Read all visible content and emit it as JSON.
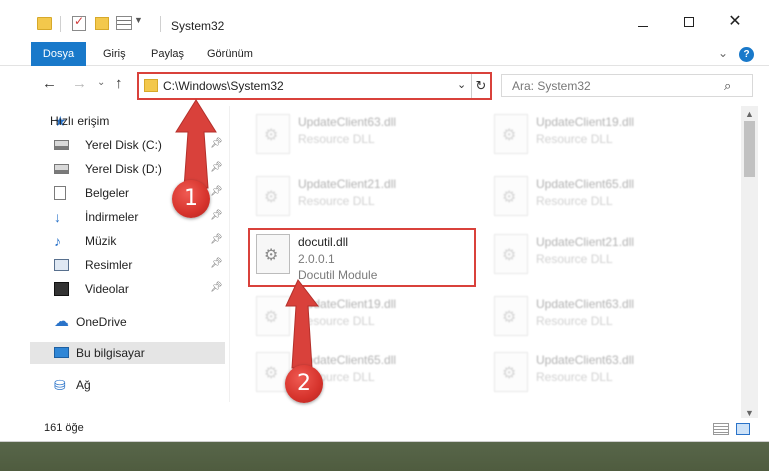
{
  "window": {
    "title": "System32",
    "controls": {
      "minimize": "—",
      "maximize": "",
      "close": "✕"
    }
  },
  "ribbon": {
    "tabs": [
      "Dosya",
      "Giriş",
      "Paylaş",
      "Görünüm"
    ],
    "help": "?",
    "collapse": "⌄"
  },
  "nav": {
    "back": "←",
    "forward": "→",
    "recent": "⌄",
    "up": "↑",
    "address": "C:\\Windows\\System32",
    "address_dropdown": "⌄",
    "refresh": "↻",
    "search_placeholder": "Ara: System32",
    "search_icon": "⚲"
  },
  "sidebar": {
    "items": [
      {
        "label": "Hızlı erişim",
        "icon": "star-icon",
        "glyph": "★",
        "pinned": false
      },
      {
        "label": "Yerel Disk (C:)",
        "icon": "disk-icon",
        "glyph": "",
        "pinned": true
      },
      {
        "label": "Yerel Disk (D:)",
        "icon": "disk-icon",
        "glyph": "",
        "pinned": true
      },
      {
        "label": "Belgeler",
        "icon": "document-icon",
        "glyph": "",
        "pinned": true
      },
      {
        "label": "İndirmeler",
        "icon": "download-icon",
        "glyph": "↓",
        "pinned": true
      },
      {
        "label": "Müzik",
        "icon": "music-icon",
        "glyph": "♪",
        "pinned": true
      },
      {
        "label": "Resimler",
        "icon": "pictures-icon",
        "glyph": "",
        "pinned": true
      },
      {
        "label": "Videolar",
        "icon": "video-icon",
        "glyph": "",
        "pinned": true
      },
      {
        "label": "OneDrive",
        "icon": "cloud-icon",
        "glyph": "☁",
        "pinned": false
      },
      {
        "label": "Bu bilgisayar",
        "icon": "computer-icon",
        "glyph": "",
        "pinned": false
      },
      {
        "label": "Ağ",
        "icon": "network-icon",
        "glyph": "⛁",
        "pinned": false
      }
    ],
    "pin_glyph": "📌"
  },
  "files": {
    "left": [
      {
        "name": "UpdateClient63.dll",
        "desc": "Resource DLL"
      },
      {
        "name": "UpdateClient21.dll",
        "desc": "Resource DLL"
      },
      {
        "name": "UpdateClient19.dll",
        "desc": "Resource DLL"
      },
      {
        "name": "UpdateClient65.dll",
        "desc": "Resource DLL"
      }
    ],
    "right": [
      {
        "name": "UpdateClient19.dll",
        "desc": "Resource DLL"
      },
      {
        "name": "UpdateClient65.dll",
        "desc": "Resource DLL"
      },
      {
        "name": "UpdateClient21.dll",
        "desc": "Resource DLL"
      },
      {
        "name": "UpdateClient63.dll",
        "desc": "Resource DLL"
      },
      {
        "name": "UpdateClient63.dll",
        "desc": "Resource DLL"
      }
    ],
    "selected": {
      "name": "docutil.dll",
      "version": "2.0.0.1",
      "desc": "Docutil Module"
    }
  },
  "status": {
    "count": "161 öğe"
  },
  "annotations": {
    "step1": "1",
    "step2": "2",
    "color": "#d9413b"
  }
}
